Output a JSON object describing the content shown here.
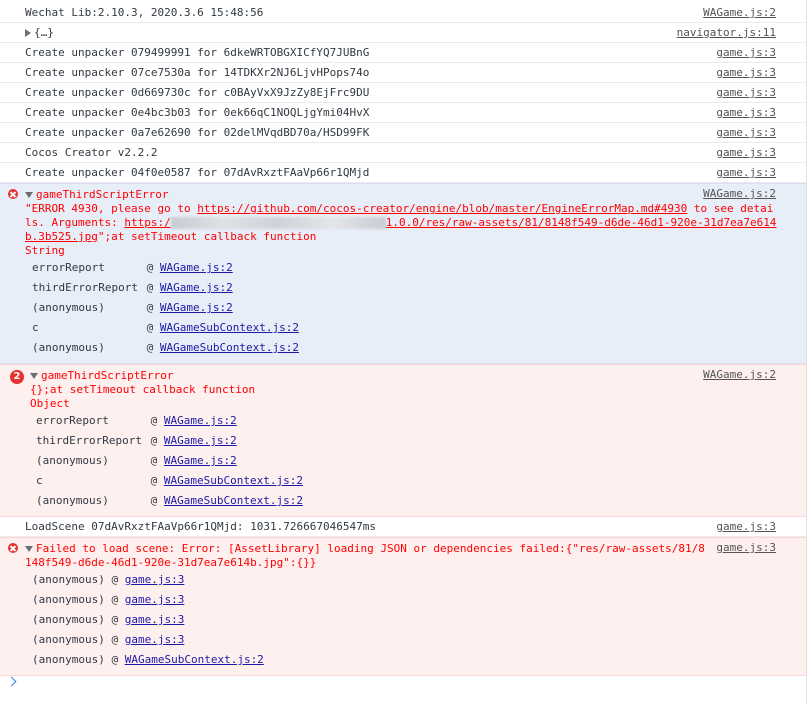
{
  "logs_top": [
    {
      "text": "Wechat Lib:2.10.3, 2020.3.6 15:48:56",
      "source": "WAGame.js:2"
    },
    {
      "text": "{…}",
      "source": "navigator.js:11",
      "expandable": true
    },
    {
      "text": "Create unpacker 079499991 for 6dkeWRTOBGXICfYQ7JUBnG",
      "source": "game.js:3"
    },
    {
      "text": "Create unpacker 07ce7530a for 14TDKXr2NJ6LjvHPops74o",
      "source": "game.js:3"
    },
    {
      "text": "Create unpacker 0d669730c for c0BAyVxX9JzZy8EjFrc9DU",
      "source": "game.js:3"
    },
    {
      "text": "Create unpacker 0e4bc3b03 for 0ek66qC1NOQLjgYmi04HvX",
      "source": "game.js:3"
    },
    {
      "text": "Create unpacker 0a7e62690 for 02delMVqdBD70a/HSD99FK",
      "source": "game.js:3"
    },
    {
      "text": "Cocos Creator v2.2.2",
      "source": "game.js:3"
    },
    {
      "text": "Create unpacker 04f0e0587 for 07dAvRxztFAaVp66r1QMjd",
      "source": "game.js:3"
    }
  ],
  "error1": {
    "title": "gameThirdScriptError",
    "source": "WAGame.js:2",
    "msg_a": "\"ERROR 4930, please go to ",
    "link1": "https://github.com/cocos-creator/engine/blob/master/EngineErrorMap.md#4930",
    "msg_b": " to see details. Arguments: ",
    "link2_a": "https:/",
    "link2_b": "1.0.0/res/raw-assets/81/8148f549-d6de-46d1-920e-31d7ea7e614b.3b525.jpg",
    "msg_c": "\";at setTimeout callback function",
    "type": "String",
    "stack": [
      {
        "fn": "errorReport",
        "src": "WAGame.js:2"
      },
      {
        "fn": "thirdErrorReport",
        "src": "WAGame.js:2"
      },
      {
        "fn": "(anonymous)",
        "src": "WAGame.js:2"
      },
      {
        "fn": "c",
        "src": "WAGameSubContext.js:2"
      },
      {
        "fn": "(anonymous)",
        "src": "WAGameSubContext.js:2"
      }
    ]
  },
  "error2": {
    "count": "2",
    "title": "gameThirdScriptError",
    "source": "WAGame.js:2",
    "message": "{};at setTimeout callback function",
    "type": "Object",
    "stack": [
      {
        "fn": "errorReport",
        "src": "WAGame.js:2"
      },
      {
        "fn": "thirdErrorReport",
        "src": "WAGame.js:2"
      },
      {
        "fn": "(anonymous)",
        "src": "WAGame.js:2"
      },
      {
        "fn": "c",
        "src": "WAGameSubContext.js:2"
      },
      {
        "fn": "(anonymous)",
        "src": "WAGameSubContext.js:2"
      }
    ]
  },
  "log_scene": {
    "text": "LoadScene 07dAvRxztFAaVp66r1QMjd: 1031.726667046547ms",
    "source": "game.js:3"
  },
  "error3": {
    "message": "Failed to load scene: Error: [AssetLibrary] loading JSON or dependencies failed:{\"res/raw-assets/81/8148f549-d6de-46d1-920e-31d7ea7e614b.jpg\":{}}",
    "source": "game.js:3",
    "stack": [
      {
        "fn": "(anonymous)",
        "src": "game.js:3"
      },
      {
        "fn": "(anonymous)",
        "src": "game.js:3"
      },
      {
        "fn": "(anonymous)",
        "src": "game.js:3"
      },
      {
        "fn": "(anonymous)",
        "src": "game.js:3"
      },
      {
        "fn": "(anonymous)",
        "src": "WAGameSubContext.js:2"
      }
    ]
  },
  "colors": {
    "error_text": "#ff0000",
    "error_bg": "#fff0f0",
    "selected_error_bg": "#e8eef8",
    "link": "#1a1aa6"
  },
  "icons": {
    "error": "error-x-icon",
    "expand": "triangle-right-icon",
    "collapse": "triangle-down-icon",
    "prompt": "chevron-right-icon"
  }
}
